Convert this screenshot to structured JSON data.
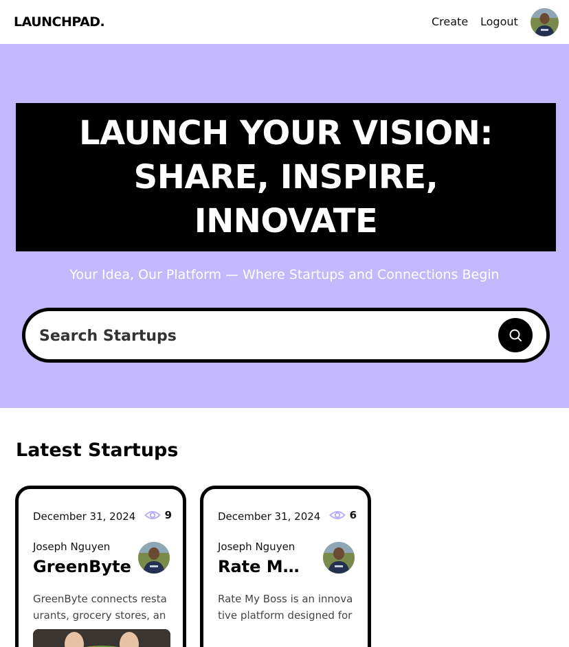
{
  "header": {
    "logo_text": "LAUNCHPAD.",
    "nav": {
      "create_label": "Create",
      "logout_label": "Logout"
    }
  },
  "hero": {
    "headline": "LAUNCH YOUR VISION: SHARE, INSPIRE, INNOVATE",
    "subtitle": "Your Idea, Our Platform — Where Startups and Connections Begin",
    "search": {
      "placeholder": "Search Startups",
      "value": ""
    }
  },
  "section": {
    "title": "Latest Startups"
  },
  "cards": [
    {
      "date": "December 31, 2024",
      "views": "9",
      "author": "Joseph Nguyen",
      "title": "GreenByte",
      "description": "GreenByte connects restaurants, grocery stores, and food banks to reduce food waste."
    },
    {
      "date": "December 31, 2024",
      "views": "6",
      "author": "Joseph Nguyen",
      "title": "Rate My Boss",
      "description": "Rate My Boss is an innovative platform designed for employees to review managers."
    }
  ],
  "colors": {
    "hero_bg": "#c3b8fc",
    "accent": "#c3b8fc",
    "eye_icon": "#b9aef7"
  }
}
